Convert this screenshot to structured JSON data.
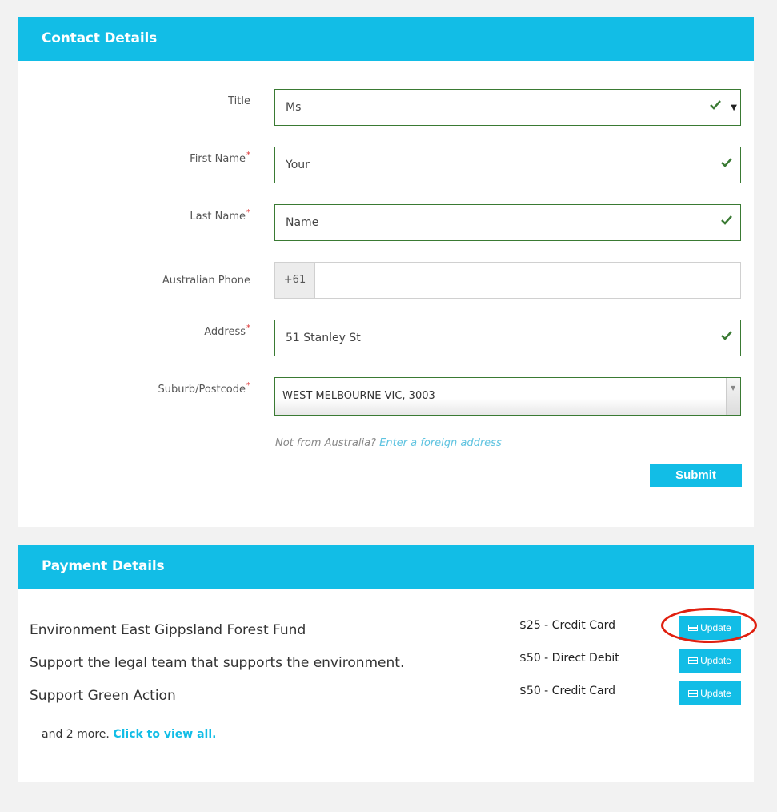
{
  "contact": {
    "header": "Contact Details",
    "title_label": "Title",
    "title_value": "Ms",
    "first_name_label": "First Name",
    "first_name_value": "Your",
    "last_name_label": "Last Name",
    "last_name_value": "Name",
    "phone_label": "Australian Phone",
    "phone_prefix": "+61",
    "phone_value": "",
    "address_label": "Address",
    "address_value": "51 Stanley St",
    "suburb_label": "Suburb/Postcode",
    "suburb_value": "WEST MELBOURNE VIC, 3003",
    "foreign_text": "Not from Australia?",
    "foreign_link": "Enter a foreign address",
    "submit_label": "Submit",
    "required_marker": "*"
  },
  "payment": {
    "header": "Payment Details",
    "items": [
      {
        "fund": "Environment East Gippsland Forest Fund",
        "amount": "$25 - Credit Card",
        "button": "Update"
      },
      {
        "fund": "Support the legal team that supports the environment.",
        "amount": "$50 - Direct Debit",
        "button": "Update"
      },
      {
        "fund": "Support Green Action",
        "amount": "$50 - Credit Card",
        "button": "Update"
      }
    ],
    "more_text": "and 2 more.",
    "more_link": "Click to view all."
  },
  "colors": {
    "accent": "#12bde6",
    "valid_border": "#3a7a33",
    "check": "#3a7a33",
    "required": "#d33",
    "highlight": "#e02010"
  },
  "icons": [
    "check-icon",
    "dropdown-caret-icon",
    "card-icon"
  ]
}
